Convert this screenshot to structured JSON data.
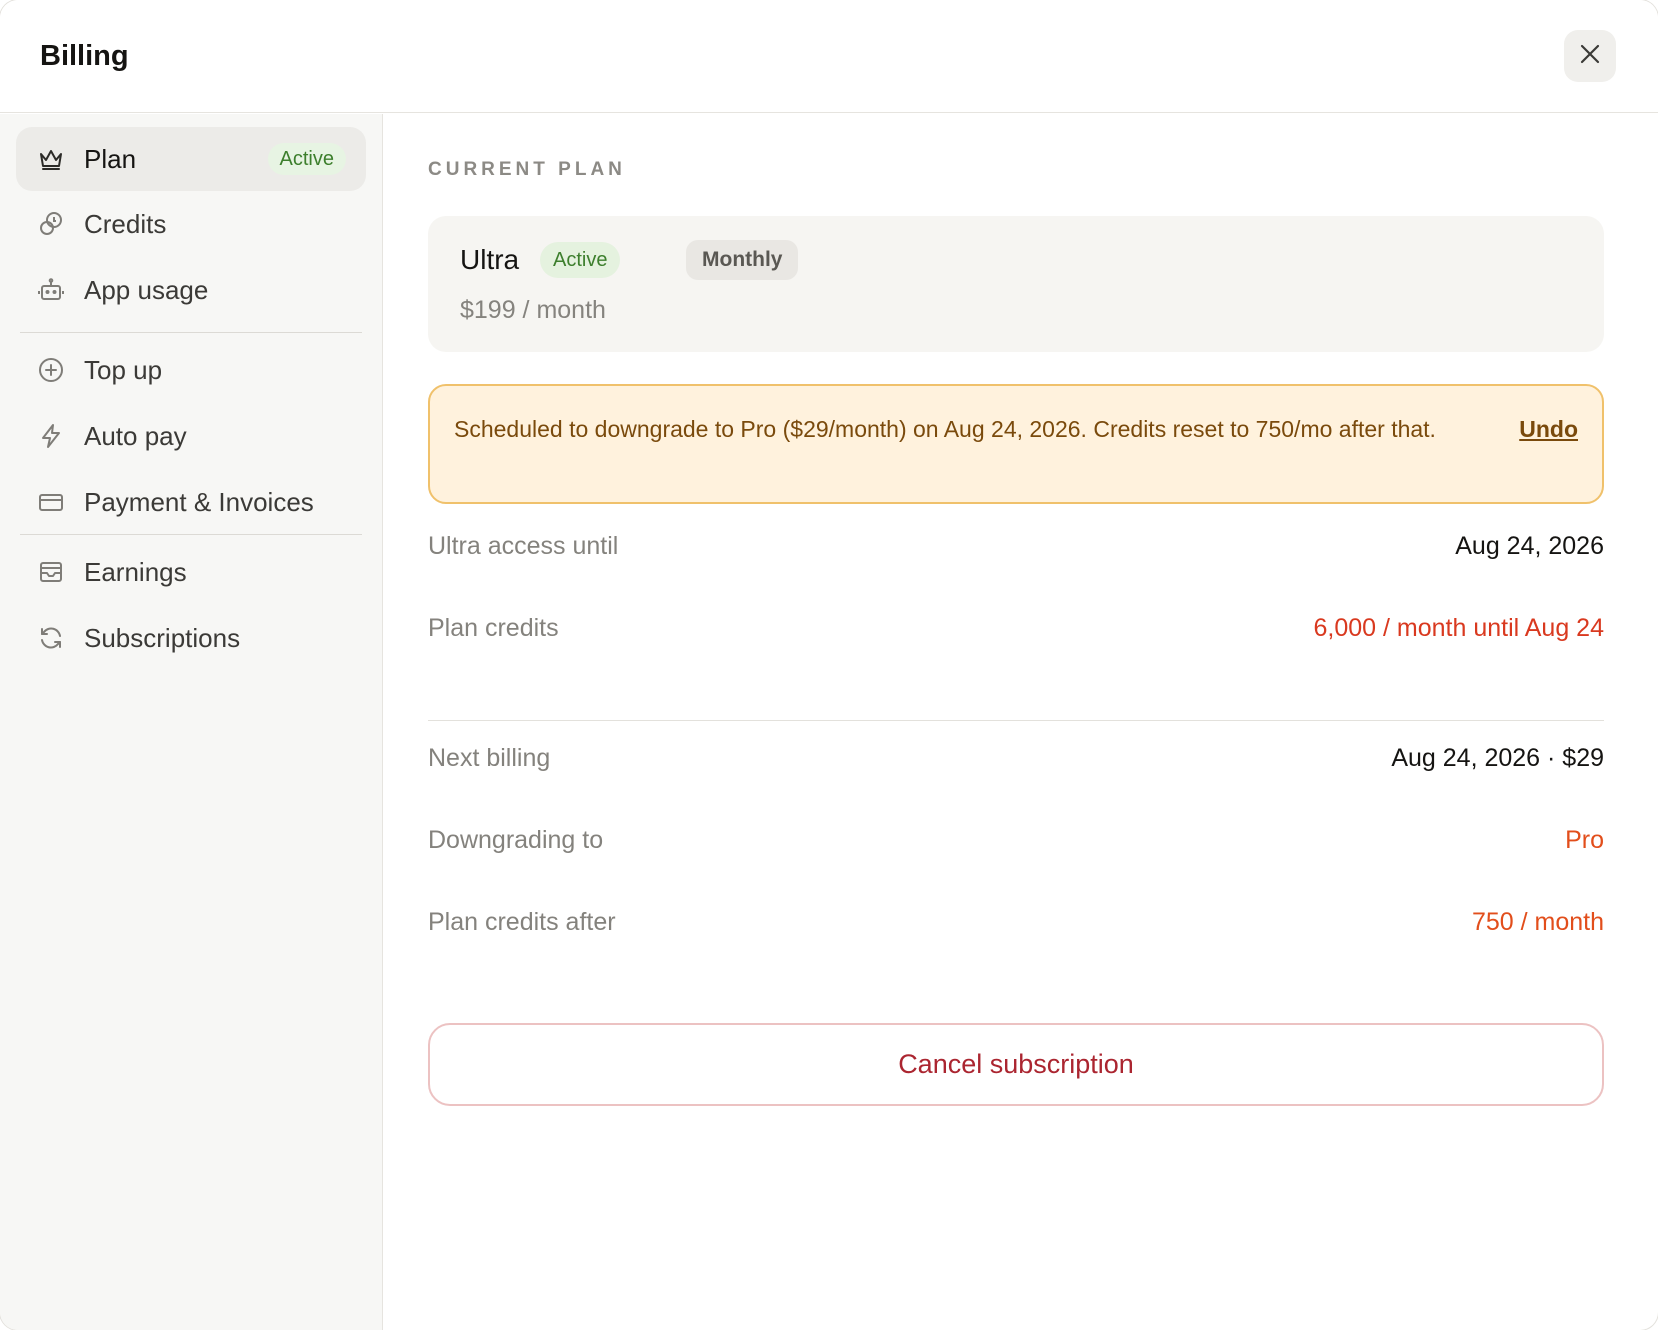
{
  "header": {
    "title": "Billing",
    "close_icon": "close-icon"
  },
  "sidebar": {
    "items": [
      {
        "label": "Plan",
        "icon": "crown-icon",
        "badge": "Active",
        "active": true
      },
      {
        "label": "Credits",
        "icon": "coins-icon"
      },
      {
        "label": "App usage",
        "icon": "robot-icon"
      },
      {
        "label": "Top up",
        "icon": "plus-circle-icon"
      },
      {
        "label": "Auto pay",
        "icon": "lightning-icon"
      },
      {
        "label": "Payment & Invoices",
        "icon": "credit-card-icon"
      },
      {
        "label": "Earnings",
        "icon": "inbox-icon"
      },
      {
        "label": "Subscriptions",
        "icon": "refresh-icon"
      }
    ]
  },
  "main": {
    "section_label": "CURRENT PLAN",
    "plan": {
      "name": "Ultra",
      "status": "Active",
      "cycle": "Monthly",
      "price": "$199 / month"
    },
    "alert": {
      "text": "Scheduled to downgrade to Pro ($29/month) on Aug 24, 2026. Credits reset to 750/mo after that.",
      "undo_label": "Undo"
    },
    "details": [
      {
        "label": "Ultra access until",
        "value": "Aug 24, 2026"
      },
      {
        "label": "Plan credits",
        "value": "6,000 / month until Aug 24"
      },
      {
        "label": "Next billing",
        "value": "Aug 24, 2026 · $29"
      },
      {
        "label": "Downgrading to",
        "value": "Pro"
      },
      {
        "label": "Plan credits after",
        "value": "750 / month"
      }
    ],
    "cancel_label": "Cancel subscription"
  },
  "colors": {
    "accent_green": "#3d7f2d",
    "warning_bg": "#fff2dd",
    "warning_border": "#f0c16b",
    "red_value": "#d9391f",
    "orange_value": "#e24e1b",
    "danger_text": "#ab2530"
  }
}
